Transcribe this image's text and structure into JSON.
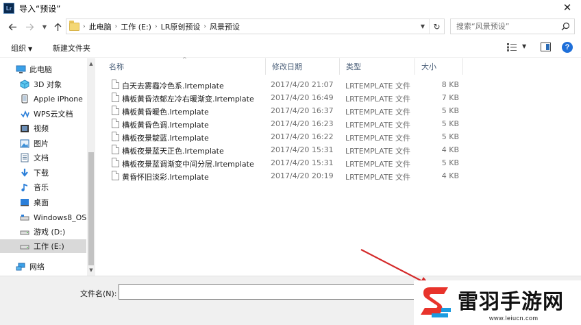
{
  "window": {
    "app_icon": "Lr",
    "title": "导入“预设”",
    "close_glyph": "✕"
  },
  "address": {
    "breadcrumbs": [
      "此电脑",
      "工作 (E:)",
      "LR原创预设",
      "风景预设"
    ],
    "search_placeholder": "搜索“风景预设”"
  },
  "toolbar": {
    "organize_label": "组织",
    "new_folder_label": "新建文件夹",
    "help_glyph": "?"
  },
  "sidebar": {
    "items": [
      {
        "label": "此电脑",
        "icon": "computer-icon"
      },
      {
        "label": "3D 对象",
        "icon": "cube-icon"
      },
      {
        "label": "Apple iPhone",
        "icon": "phone-icon"
      },
      {
        "label": "WPS云文档",
        "icon": "cloud-icon"
      },
      {
        "label": "视频",
        "icon": "video-icon"
      },
      {
        "label": "图片",
        "icon": "picture-icon"
      },
      {
        "label": "文档",
        "icon": "document-icon"
      },
      {
        "label": "下载",
        "icon": "download-icon"
      },
      {
        "label": "音乐",
        "icon": "music-icon"
      },
      {
        "label": "桌面",
        "icon": "desktop-icon"
      },
      {
        "label": "Windows8_OS",
        "icon": "drive-icon"
      },
      {
        "label": "游戏 (D:)",
        "icon": "drive-icon"
      },
      {
        "label": "工作 (E:)",
        "icon": "drive-icon",
        "selected": true
      },
      {
        "label": "网络",
        "icon": "network-icon"
      }
    ]
  },
  "columns": {
    "name": "名称",
    "date": "修改日期",
    "type": "类型",
    "size": "大小"
  },
  "files": [
    {
      "name": "白天去雾霾冷色系.lrtemplate",
      "date": "2017/4/20 21:07",
      "type": "LRTEMPLATE 文件",
      "size": "8 KB"
    },
    {
      "name": "横板黄昏浓郁左冷右暖渐变.lrtemplate",
      "date": "2017/4/20 16:49",
      "type": "LRTEMPLATE 文件",
      "size": "7 KB"
    },
    {
      "name": "横板黄昏暖色.lrtemplate",
      "date": "2017/4/20 16:37",
      "type": "LRTEMPLATE 文件",
      "size": "5 KB"
    },
    {
      "name": "横板黄昏色调.lrtemplate",
      "date": "2017/4/20 16:23",
      "type": "LRTEMPLATE 文件",
      "size": "5 KB"
    },
    {
      "name": "横板夜景靛蓝.lrtemplate",
      "date": "2017/4/20 16:22",
      "type": "LRTEMPLATE 文件",
      "size": "5 KB"
    },
    {
      "name": "横板夜景蓝天正色.lrtemplate",
      "date": "2017/4/20 15:31",
      "type": "LRTEMPLATE 文件",
      "size": "4 KB"
    },
    {
      "name": "横板夜景蓝调渐变中间分层.lrtemplate",
      "date": "2017/4/20 15:31",
      "type": "LRTEMPLATE 文件",
      "size": "5 KB"
    },
    {
      "name": "黄昏怀旧淡彩.lrtemplate",
      "date": "2017/4/20 20:19",
      "type": "LRTEMPLATE 文件",
      "size": "4 KB"
    }
  ],
  "bottom": {
    "filename_label": "文件名(N):",
    "filename_value": ""
  },
  "watermark": {
    "title": "雷羽手游网",
    "url": "www.leiucn.com"
  },
  "colors": {
    "accent": "#1e6fd9",
    "annotation_arrow": "#d42a2a",
    "watermark_red": "#e8332b",
    "watermark_blue": "#1b9be0"
  }
}
